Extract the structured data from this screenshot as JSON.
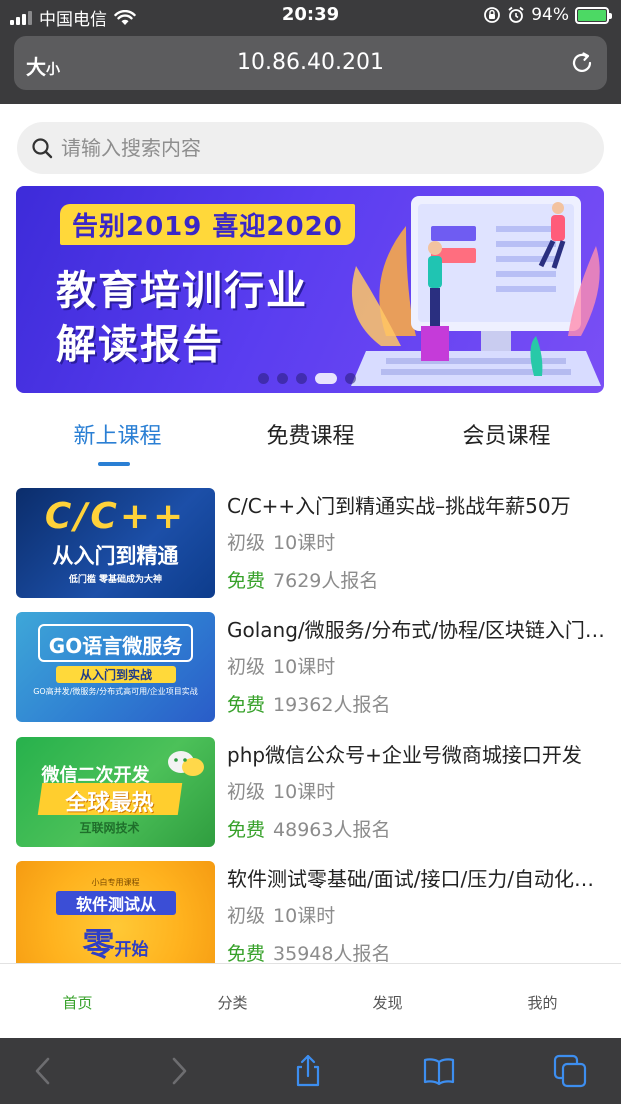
{
  "status_bar": {
    "carrier": "中国电信",
    "time": "20:39",
    "battery": "94%"
  },
  "address_bar": {
    "text_size_label_big": "大",
    "text_size_label_small": "小",
    "url": "10.86.40.201"
  },
  "search": {
    "placeholder": "请输入搜索内容"
  },
  "banner": {
    "tag": "告别2019 喜迎2020",
    "line1": "教育培训行业",
    "line2": "解读报告",
    "slide_count": 5,
    "active_slide": 4
  },
  "tabs": [
    {
      "label": "新上课程",
      "active": true
    },
    {
      "label": "免费课程",
      "active": false
    },
    {
      "label": "会员课程",
      "active": false
    }
  ],
  "courses": [
    {
      "title": "C/C++入门到精通实战–挑战年薪50万",
      "level": "初级",
      "lessons": "10课时",
      "price": "免费",
      "enrolled": "7629人报名",
      "thumb_line1": "C/C++",
      "thumb_line2": "从入门到精通",
      "thumb_line3": "低门槛 零基础成为大神"
    },
    {
      "title": "Golang/微服务/分布式/协程/区块链入门实战",
      "level": "初级",
      "lessons": "10课时",
      "price": "免费",
      "enrolled": "19362人报名",
      "thumb_line1": "GO语言微服务",
      "thumb_line2": "从入门到实战",
      "thumb_line3": "GO高并发/微服务/分布式高可用/企业项目实战"
    },
    {
      "title": "php微信公众号+企业号微商城接口开发",
      "level": "初级",
      "lessons": "10课时",
      "price": "免费",
      "enrolled": "48963人报名",
      "thumb_line1": "微信二次开发",
      "thumb_line2": "全球最热",
      "thumb_line3": "互联网技术"
    },
    {
      "title": "软件测试零基础/面试/接口/压力/自动化测试",
      "level": "初级",
      "lessons": "10课时",
      "price": "免费",
      "enrolled": "35948人报名",
      "thumb_line1": "小白专用课程",
      "thumb_line2": "软件测试从",
      "thumb_line3": "零",
      "thumb_line4": "开始"
    }
  ],
  "bottom_nav": [
    {
      "label": "首页",
      "active": true
    },
    {
      "label": "分类",
      "active": false
    },
    {
      "label": "发现",
      "active": false
    },
    {
      "label": "我的",
      "active": false
    }
  ],
  "colors": {
    "accent_blue": "#2a7fd4",
    "free_green": "#37a12a",
    "safari_chrome": "#3b3b3d"
  }
}
